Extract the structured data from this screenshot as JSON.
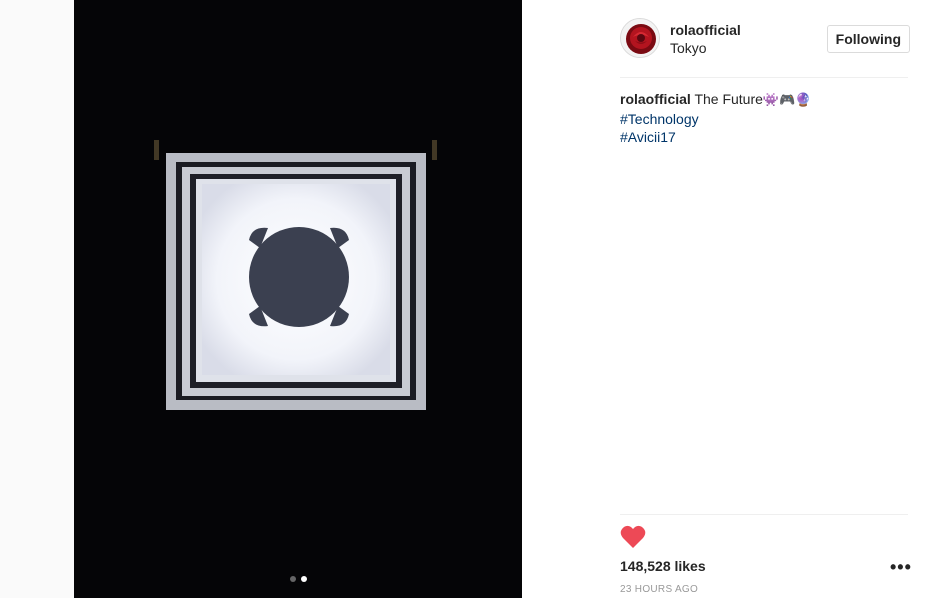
{
  "post": {
    "username": "rolaofficial",
    "location": "Tokyo",
    "follow_label": "Following",
    "caption": {
      "username": "rolaofficial",
      "text": "The Future",
      "emoji": "👾🎮🔮",
      "hashtags": [
        "#Technology",
        "#Avicii17"
      ]
    },
    "likes": "148,528 likes",
    "timestamp": "23 HOURS AGO",
    "more_label": "•••",
    "carousel": {
      "count": 2,
      "active_index": 2
    }
  },
  "colors": {
    "media_bg": "#050507",
    "heart": "#ed4956",
    "hashtag": "#003569",
    "text": "#262626",
    "muted": "#999999"
  },
  "icons": {
    "avatar": "rose-avatar-icon",
    "heart": "heart-icon",
    "more": "more-options-icon"
  }
}
